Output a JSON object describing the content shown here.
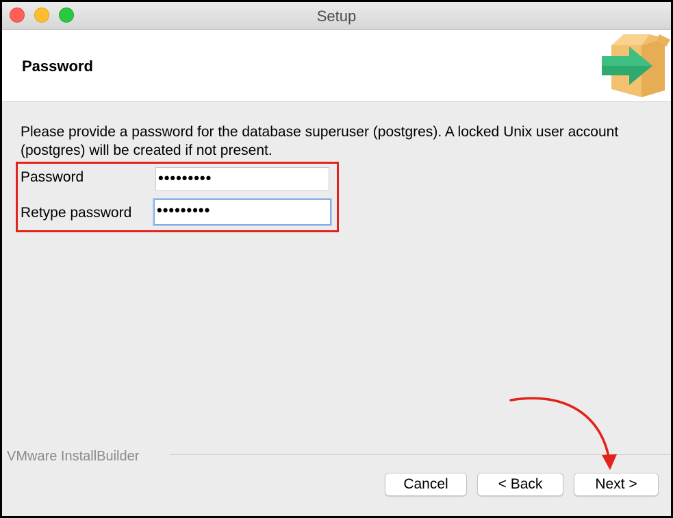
{
  "window": {
    "title": "Setup"
  },
  "header": {
    "title": "Password",
    "icon": "installer-box-arrow-icon"
  },
  "content": {
    "intro": "Please provide a password for the database superuser (postgres). A locked Unix user account (postgres) will be created if not present.",
    "fields": [
      {
        "label": "Password",
        "value": "•••••••••"
      },
      {
        "label": "Retype password",
        "value": "•••••••••"
      }
    ]
  },
  "footer": {
    "brand": "VMware InstallBuilder",
    "cancel_label": "Cancel",
    "back_label": "< Back",
    "next_label": "Next >"
  },
  "colors": {
    "annotation_red": "#e2221b",
    "focus_blue": "#7fa6de",
    "box_tan": "#f0be6a",
    "arrow_green": "#2eaa6e"
  }
}
